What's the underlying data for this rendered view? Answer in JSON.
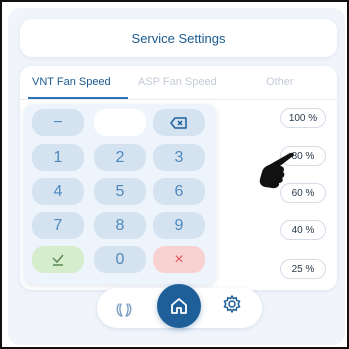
{
  "header": {
    "title": "Service Settings"
  },
  "tabs": [
    {
      "label": "VNT Fan Speed",
      "active": true
    },
    {
      "label": "ASP Fan Speed",
      "active": false
    },
    {
      "label": "Other",
      "active": false
    }
  ],
  "speed_values": [
    "100 %",
    "80 %",
    "60 %",
    "40 %",
    "25 %"
  ],
  "keypad": {
    "minus": "−",
    "display_value": "",
    "backspace_icon": "backspace-icon",
    "digits": [
      "1",
      "2",
      "3",
      "4",
      "5",
      "6",
      "7",
      "8",
      "9",
      "0"
    ],
    "ok_icon": "check-icon",
    "cancel": "×"
  },
  "nav": {
    "items": [
      "fan-icon",
      "home-icon",
      "gear-icon"
    ],
    "active": "home-icon"
  },
  "colors": {
    "accent": "#1f5f99",
    "key_bg": "#d5e3f1",
    "ok_bg": "#d5edcc",
    "cancel_bg": "#f8d1d1"
  }
}
